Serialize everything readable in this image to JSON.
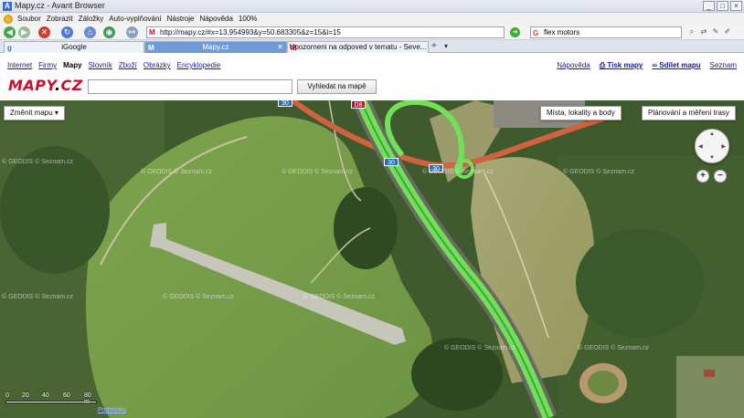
{
  "window": {
    "title": "Mapy.cz - Avant Browser",
    "controls": [
      "_",
      "□",
      "×"
    ]
  },
  "menu": {
    "items": [
      "Soubor",
      "Zobrazit",
      "Záložky",
      "Auto-vyplňování",
      "Nástroje",
      "Nápověda",
      "100%"
    ]
  },
  "nav": {
    "address": "http://mapy.cz/#x=13.954993&y=50.683305&z=15&l=15",
    "search_value": "flex motors"
  },
  "tabs": [
    {
      "label": "iGoogle"
    },
    {
      "label": "Mapy.cz"
    },
    {
      "label": "Upozorneni na odpoved v tematu - Seve..."
    }
  ],
  "page": {
    "services": [
      "Internet",
      "Firmy",
      "Mapy",
      "Slovník",
      "Zboží",
      "Obrázky",
      "Encyklopedie"
    ],
    "current_service": "Mapy",
    "right_links": [
      "Nápověda",
      "Tisk mapy",
      "Sdílet mapu",
      "Seznam"
    ],
    "brand": {
      "main": "MAPY",
      "dot": ".",
      "tld": "CZ"
    },
    "search_button": "Vyhledat na mapě"
  },
  "map": {
    "change_map": "Změnit mapu",
    "places_button": "Místa, lokality a body",
    "planning_button": "Plánování a měření trasy",
    "road_number": "30",
    "road_number_top": "D8",
    "scale_labels": [
      "0",
      "20",
      "40",
      "60",
      "80 m"
    ],
    "watermark": "© GEODIS © Seznam.cz",
    "copyright_link": "Podmínky"
  }
}
